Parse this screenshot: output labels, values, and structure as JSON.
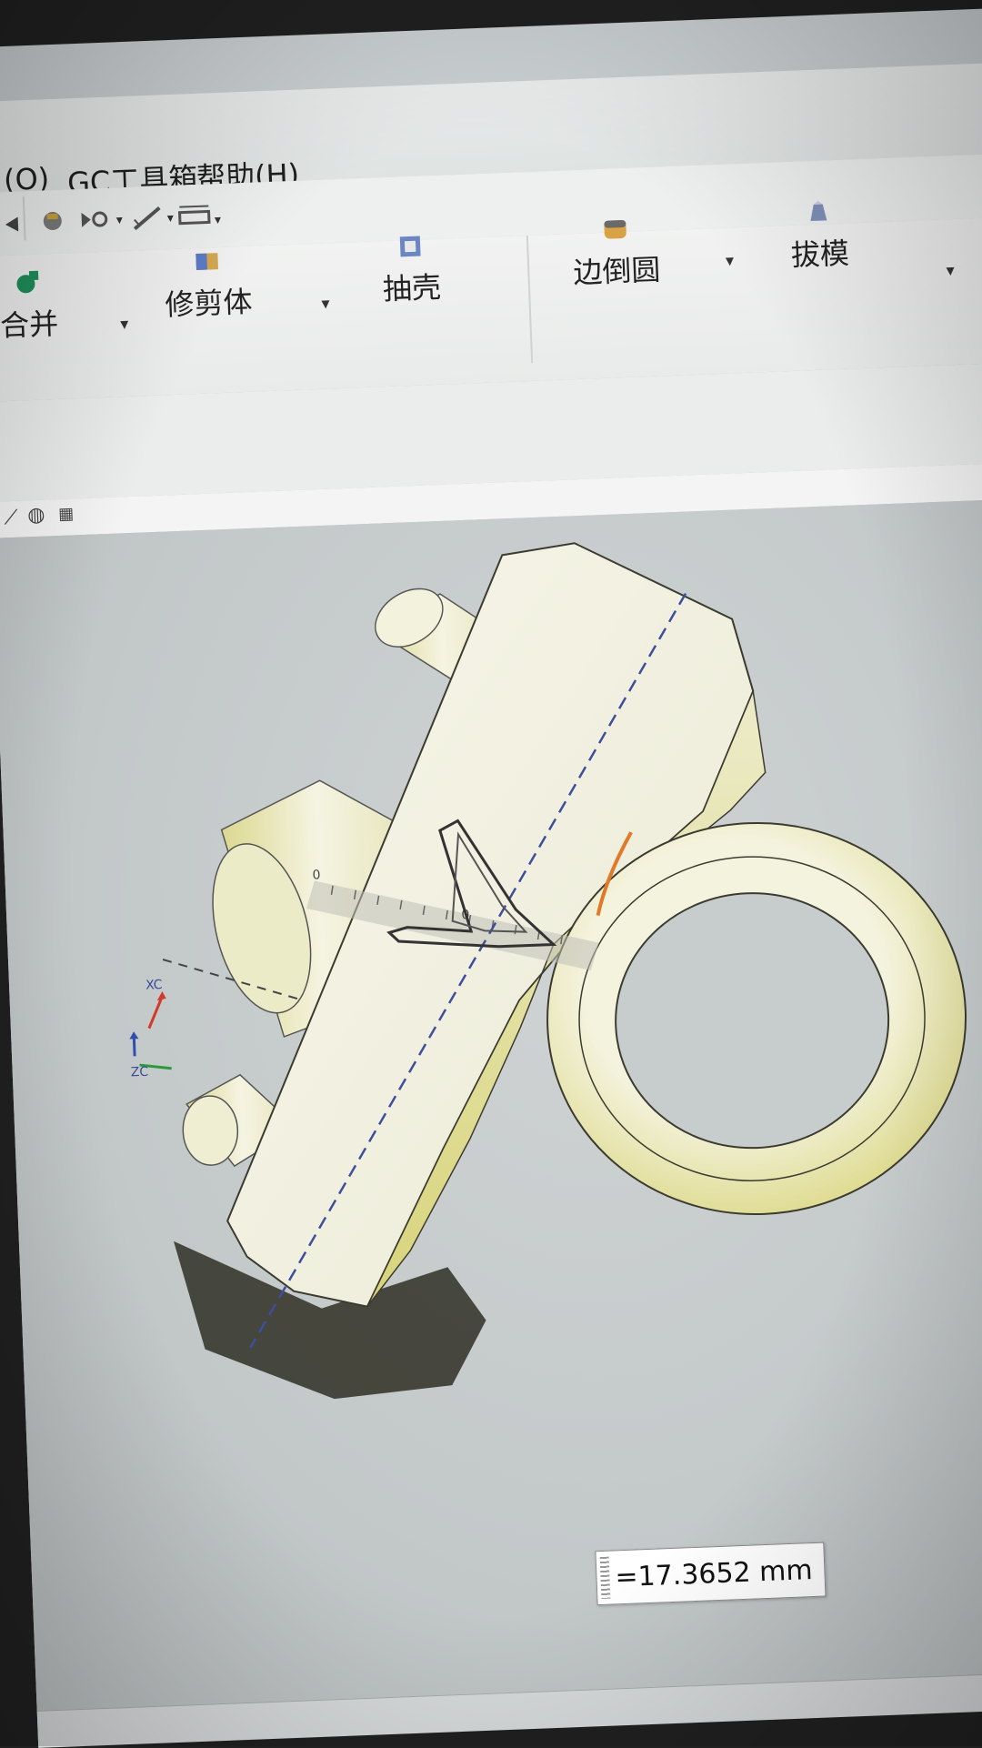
{
  "menubar": {
    "items": [
      "(O)",
      "GC工具箱",
      "帮助(H)"
    ]
  },
  "ribbon": {
    "tools": [
      {
        "label": "合并",
        "icon": "unite-icon"
      },
      {
        "label": "修剪体",
        "icon": "trim-body-icon"
      },
      {
        "label": "抽壳",
        "icon": "shell-icon"
      },
      {
        "label": "边倒圆",
        "icon": "edge-blend-icon"
      },
      {
        "label": "拔模",
        "icon": "draft-icon"
      }
    ]
  },
  "viewport": {
    "measurement": "=17.3652 mm",
    "axis_labels": [
      "XC",
      "ZC"
    ],
    "ruler_zero": "0"
  },
  "colors": {
    "part": "#f2f1dc",
    "part_shadow": "#e3e09a",
    "centerline": "#3d4f9c",
    "measure_edge": "#e07a2b",
    "background": "#c6cbcc"
  }
}
